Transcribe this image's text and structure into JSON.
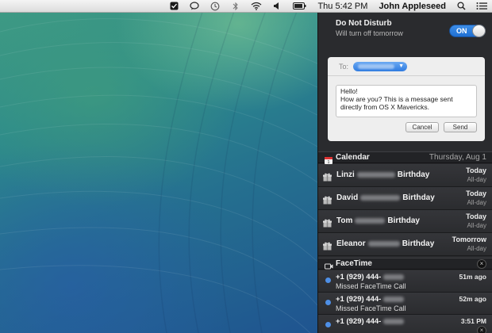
{
  "menubar": {
    "clock": "Thu 5:42 PM",
    "user": "John Appleseed",
    "icons": [
      "checklist-icon",
      "speech-bubble-icon",
      "time-machine-icon",
      "bluetooth-icon",
      "wifi-icon",
      "volume-icon",
      "battery-icon",
      "search-icon",
      "list-icon"
    ]
  },
  "dnd": {
    "title": "Do Not Disturb",
    "subtitle": "Will turn off tomorrow",
    "toggle": "ON"
  },
  "share": {
    "to_label": "To:",
    "message": "Hello!\nHow are you? This is a message sent directly from OS X Mavericks.",
    "cancel": "Cancel",
    "send": "Send"
  },
  "calendar": {
    "title": "Calendar",
    "date": "Thursday, Aug 1",
    "events": [
      {
        "name": "Linzi",
        "suffix": "Birthday",
        "when": "Today",
        "allday": "All-day"
      },
      {
        "name": "David",
        "suffix": "Birthday",
        "when": "Today",
        "allday": "All-day"
      },
      {
        "name": "Tom",
        "suffix": "Birthday",
        "when": "Today",
        "allday": "All-day"
      },
      {
        "name": "Eleanor",
        "suffix": "Birthday",
        "when": "Tomorrow",
        "allday": "All-day"
      }
    ]
  },
  "facetime": {
    "title": "FaceTime",
    "close": "×",
    "calls": [
      {
        "number": "+1 (929) 444-",
        "desc": "Missed FaceTime Call",
        "time": "51m ago"
      },
      {
        "number": "+1 (929) 444-",
        "desc": "Missed FaceTime Call",
        "time": "52m ago"
      },
      {
        "number": "+1 (929) 444-",
        "desc": "",
        "time": "3:51 PM"
      }
    ]
  },
  "colors": {
    "toggle_on": "#2f7be0",
    "panel_bg": "#2a2b2e",
    "unread_dot": "#4e8fe6"
  }
}
